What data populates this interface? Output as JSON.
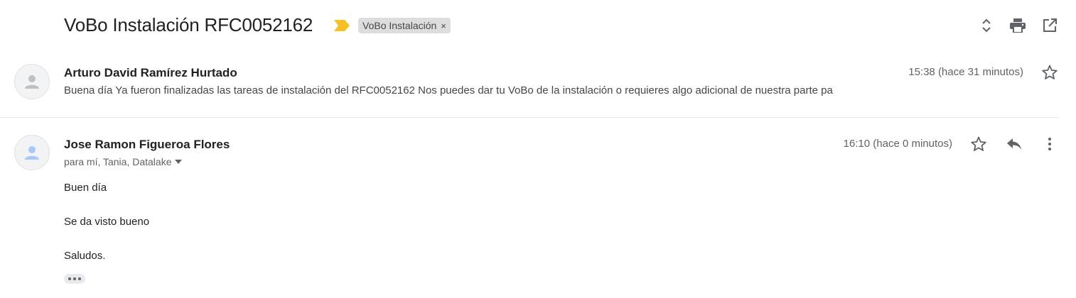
{
  "thread": {
    "subject": "VoBo Instalación RFC0052162",
    "label": "VoBo Instalación",
    "label_remove": "×"
  },
  "toolbar": {
    "icons": [
      "expand-collapse-icon",
      "print-icon",
      "open-new-window-icon"
    ]
  },
  "messages": [
    {
      "sender": "Arturo David Ramírez Hurtado",
      "time": "15:38 (hace 31 minutos)",
      "snippet": "Buena día Ya fueron finalizadas las tareas de instalación del RFC0052162 Nos puedes dar tu VoBo de la instalación o requieres algo adicional de nuestra parte pa"
    },
    {
      "sender": "Jose Ramon Figueroa Flores",
      "time": "16:10 (hace 0 minutos)",
      "recipients": "para mí, Tania, Datalake",
      "body": [
        "Buen día",
        "Se da visto bueno",
        "Saludos."
      ]
    }
  ],
  "colors": {
    "importance_marker": "#f6c026",
    "avatar_grey": "#bdc1c6",
    "avatar_blue": "#a8c7fa",
    "icon": "#5f6368"
  }
}
